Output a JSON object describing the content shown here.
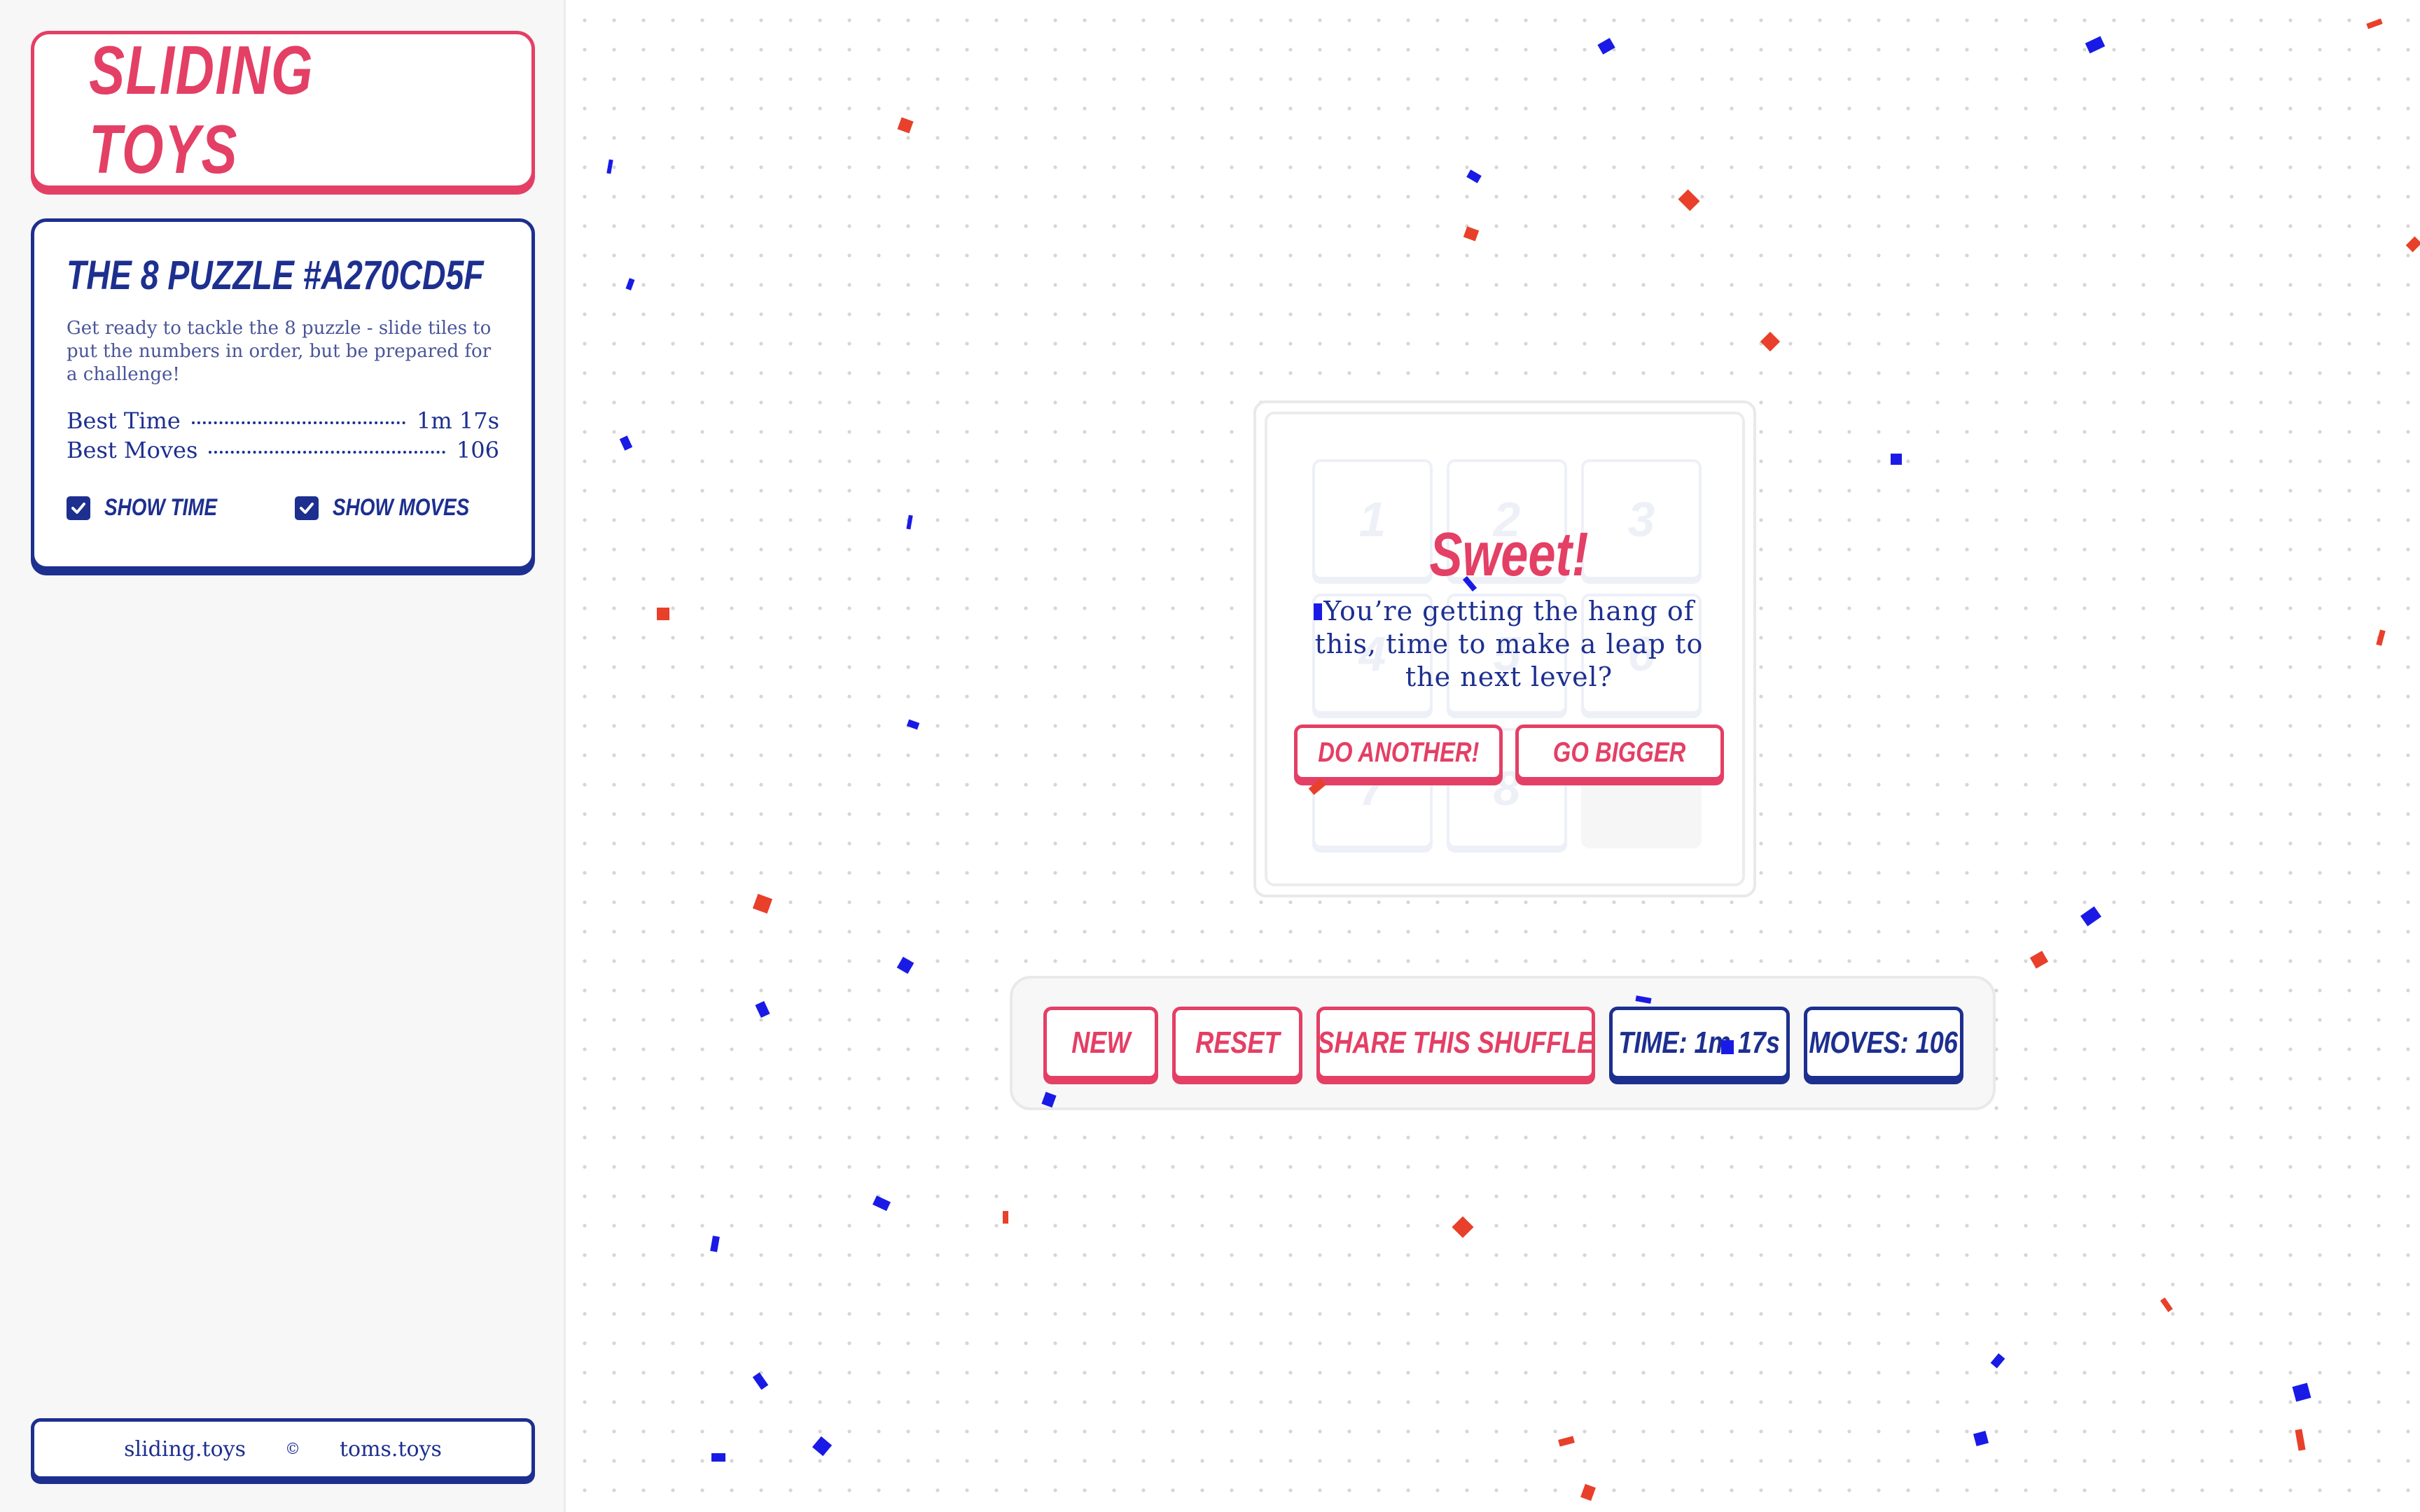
{
  "app": {
    "logo": "SLIDING TOYS"
  },
  "puzzle": {
    "title": "THE 8 PUZZLE #A270CD5F",
    "description": "Get ready to tackle the 8 puzzle - slide tiles to put the numbers in order, but be prepared for a challenge!",
    "stats": [
      {
        "label": "Best Time",
        "value": "1m 17s"
      },
      {
        "label": "Best Moves",
        "value": "106"
      }
    ],
    "options": {
      "show_time": {
        "label": "SHOW TIME",
        "checked": true
      },
      "show_moves": {
        "label": "SHOW MOVES",
        "checked": true
      }
    }
  },
  "footer": {
    "site": "sliding.toys",
    "copyright": "©",
    "owner": "toms.toys"
  },
  "board": {
    "tiles": [
      "1",
      "2",
      "3",
      "4",
      "5",
      "6",
      "7",
      "8",
      ""
    ]
  },
  "win": {
    "title": "Sweet!",
    "message": "You’re getting the hang of this, time to make a leap to the next level?",
    "do_another": "DO ANOTHER!",
    "go_bigger": "GO BIGGER"
  },
  "toolbar": {
    "new": "NEW",
    "reset": "RESET",
    "share": "SHARE THIS SHUFFLE",
    "time": "TIME: 1m 17s",
    "moves": "MOVES: 106"
  },
  "colors": {
    "accent_pink": "#e43f65",
    "accent_blue": "#1d2f8f",
    "confetti_red": "#e8402a",
    "confetti_blue": "#1a1ae6"
  }
}
